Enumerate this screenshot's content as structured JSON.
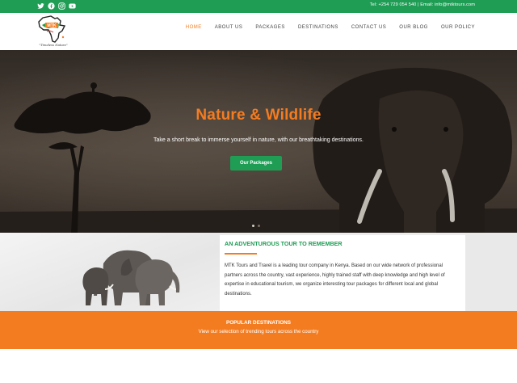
{
  "topbar": {
    "contact": "Tel: +254 729 054 540 | Email: info@mtktours.com",
    "social_icons": [
      "twitter-icon",
      "facebook-icon",
      "instagram-icon",
      "youtube-icon"
    ],
    "color": "#1f9d55"
  },
  "header": {
    "logo_text": "MTK",
    "logo_tagline": "\"Timeless Nature\"",
    "nav": [
      {
        "label": "HOME",
        "active": true
      },
      {
        "label": "ABOUT US",
        "active": false
      },
      {
        "label": "PACKAGES",
        "active": false
      },
      {
        "label": "DESTINATIONS",
        "active": false
      },
      {
        "label": "CONTACT US",
        "active": false
      },
      {
        "label": "OUR BLOG",
        "active": false
      },
      {
        "label": "OUR POLICY",
        "active": false
      }
    ]
  },
  "hero": {
    "title": "Nature & Wildlife",
    "subtitle": "Take a short break to immerse yourself in nature, with our breathtaking destinations.",
    "button": "Our Packages",
    "slides": 2,
    "active_slide": 1
  },
  "about": {
    "title": "AN ADVENTUROUS TOUR TO REMEMBER",
    "text": "MTK Tours and Travel is a leading tour company in Kenya. Based on our wide network of professional partners across the country, vast experience, highly trained staff with deep knowledge and high level of expertise in educational tourism, we organize interesting tour packages for different local and global destinations."
  },
  "popular": {
    "title": "POPULAR DESTINATIONS",
    "subtitle": "View our selection of trending tours across the country"
  },
  "colors": {
    "green": "#1f9d55",
    "orange": "#f47c20"
  }
}
